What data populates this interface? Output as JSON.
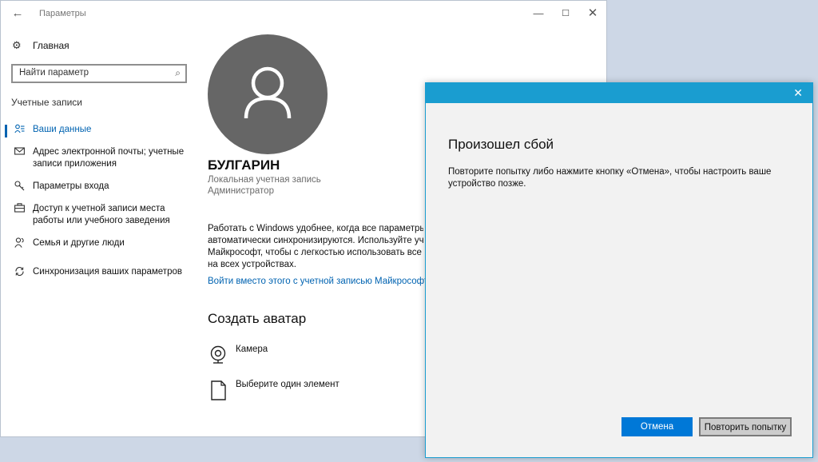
{
  "window": {
    "title": "Параметры",
    "back_icon": "←",
    "minimize_icon": "—",
    "maximize_icon": "☐",
    "close_icon": "✕"
  },
  "sidebar": {
    "home_label": "Главная",
    "home_icon": "⚙",
    "search_placeholder": "Найти параметр",
    "search_icon": "⌕",
    "section": "Учетные записи",
    "items": [
      {
        "label": "Ваши данные",
        "icon": "person-list-icon",
        "active": true
      },
      {
        "label": "Адрес электронной почты; учетные записи приложения",
        "icon": "mail-icon"
      },
      {
        "label": "Параметры входа",
        "icon": "key-icon"
      },
      {
        "label": "Доступ к учетной записи места работы или учебного заведения",
        "icon": "briefcase-icon"
      },
      {
        "label": "Семья и другие люди",
        "icon": "people-icon"
      },
      {
        "label": "Синхронизация ваших параметров",
        "icon": "sync-icon"
      }
    ]
  },
  "main": {
    "user_name": "БУЛГАРИН",
    "account_type": "Локальная учетная запись",
    "account_role": "Администратор",
    "description_lines": [
      "Работать с Windows удобнее, когда все параметры и",
      "автоматически синхронизируются. Используйте учетн",
      "Майкрософт, чтобы с легкостью использовать все сво",
      "на всех устройствах."
    ],
    "ms_link": "Войти вместо этого с учетной записью Майкрософт",
    "avatar_heading": "Создать аватар",
    "camera_label": "Камера",
    "pick_label": "Выберите один элемент"
  },
  "dialog": {
    "close_icon": "✕",
    "heading": "Произошел сбой",
    "message": "Повторите попытку либо нажмите кнопку «Отмена», чтобы настроить ваше устройство позже.",
    "cancel_label": "Отмена",
    "retry_label": "Повторить попытку",
    "accent_color": "#1a9dd0"
  }
}
